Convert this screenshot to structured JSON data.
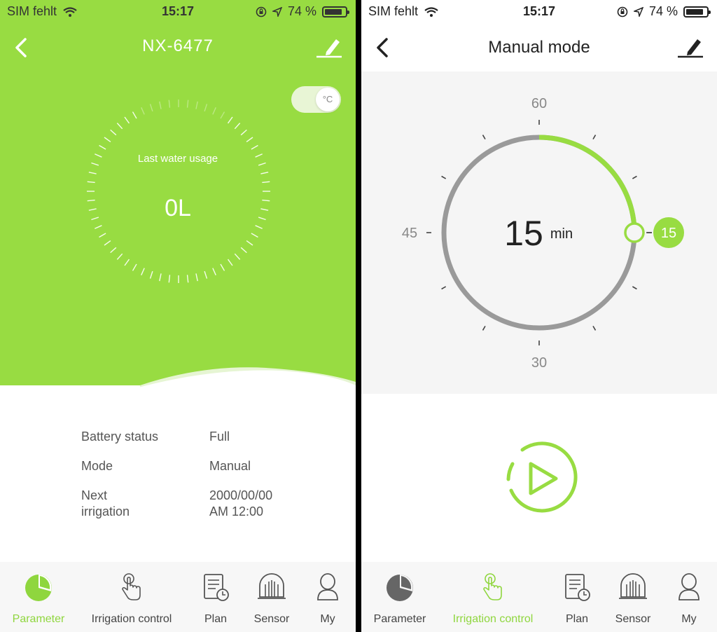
{
  "left": {
    "status": {
      "carrier": "SIM fehlt",
      "time": "15:17",
      "battery": "74 %"
    },
    "header": {
      "title": "NX-6477"
    },
    "unit_toggle": {
      "label": "°C"
    },
    "usage": {
      "label": "Last water usage",
      "value": "0L"
    },
    "info": [
      {
        "key": "Battery status",
        "value": "Full"
      },
      {
        "key": "Mode",
        "value": "Manual"
      },
      {
        "key": "Next\nirrigation",
        "value": "2000/00/00\nAM 12:00"
      }
    ],
    "tabs": [
      {
        "label": "Parameter",
        "icon": "pie-chart-icon",
        "active": true
      },
      {
        "label": "Irrigation control",
        "icon": "hand-touch-icon",
        "active": false
      },
      {
        "label": "Plan",
        "icon": "schedule-doc-icon",
        "active": false
      },
      {
        "label": "Sensor",
        "icon": "sensor-icon",
        "active": false
      },
      {
        "label": "My",
        "icon": "user-icon",
        "active": false
      }
    ]
  },
  "right": {
    "status": {
      "carrier": "SIM fehlt",
      "time": "15:17",
      "battery": "74 %"
    },
    "header": {
      "title": "Manual mode"
    },
    "dial": {
      "labels": {
        "top": "60",
        "left": "45",
        "bottom": "30"
      },
      "value": "15",
      "unit": "min",
      "badge": "15",
      "fraction": 0.25
    },
    "tabs": [
      {
        "label": "Parameter",
        "icon": "pie-chart-icon",
        "active": false
      },
      {
        "label": "Irrigation control",
        "icon": "hand-touch-icon",
        "active": true
      },
      {
        "label": "Plan",
        "icon": "schedule-doc-icon",
        "active": false
      },
      {
        "label": "Sensor",
        "icon": "sensor-icon",
        "active": false
      },
      {
        "label": "My",
        "icon": "user-icon",
        "active": false
      }
    ]
  },
  "colors": {
    "accent": "#98dc42",
    "accent_dark": "#8fd63e",
    "ring_gray": "#9a9a9a",
    "tab_text": "#444444"
  }
}
